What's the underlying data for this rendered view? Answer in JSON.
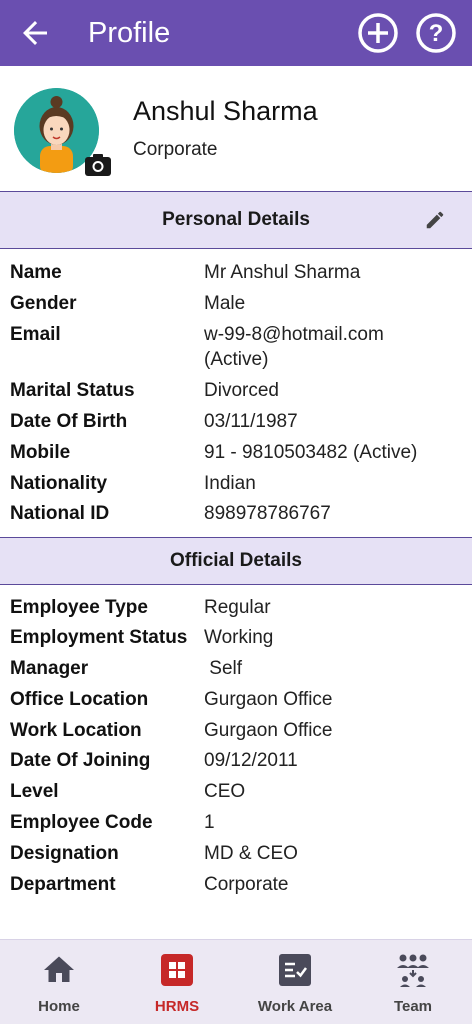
{
  "appbar": {
    "title": "Profile"
  },
  "profile": {
    "name": "Anshul Sharma",
    "role": "Corporate"
  },
  "personal": {
    "heading": "Personal Details",
    "rows": [
      {
        "label": "Name",
        "value": "Mr Anshul Sharma"
      },
      {
        "label": "Gender",
        "value": "Male"
      },
      {
        "label": "Email",
        "value": "w-99-8@hotmail.com",
        "value2": "(Active)"
      },
      {
        "label": "Marital Status",
        "value": "Divorced"
      },
      {
        "label": "Date Of Birth",
        "value": "03/11/1987"
      },
      {
        "label": "Mobile",
        "value": "91 - 9810503482 (Active)"
      },
      {
        "label": "Nationality",
        "value": "Indian"
      },
      {
        "label": "National ID",
        "value": "898978786767"
      }
    ]
  },
  "official": {
    "heading": "Official Details",
    "rows": [
      {
        "label": "Employee Type",
        "value": "Regular"
      },
      {
        "label": "Employment Status",
        "value": "Working"
      },
      {
        "label": "Manager",
        "value": " Self"
      },
      {
        "label": "Office Location",
        "value": "Gurgaon Office"
      },
      {
        "label": "Work Location",
        "value": "Gurgaon Office"
      },
      {
        "label": "Date Of Joining",
        "value": "09/12/2011"
      },
      {
        "label": "Level",
        "value": "CEO"
      },
      {
        "label": "Employee Code",
        "value": "1"
      },
      {
        "label": "Designation",
        "value": "MD & CEO"
      },
      {
        "label": "Department",
        "value": "Corporate"
      }
    ]
  },
  "nav": [
    {
      "label": "Home",
      "icon": "home-icon"
    },
    {
      "label": "HRMS",
      "icon": "hrms-grid-icon",
      "active": true
    },
    {
      "label": "Work Area",
      "icon": "work-area-icon"
    },
    {
      "label": "Team",
      "icon": "team-icon"
    }
  ],
  "colors": {
    "appbar": "#6a4fb0",
    "section": "#e6e1f5",
    "active": "#c62828",
    "avatar_bg": "#26a69a"
  }
}
